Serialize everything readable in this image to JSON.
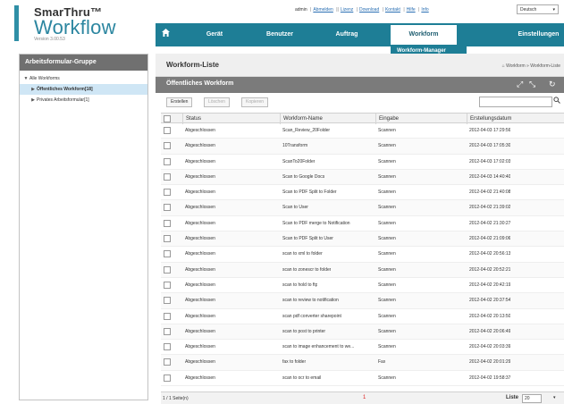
{
  "header": {
    "brand": "SmarThru™",
    "app_name": "Workflow",
    "version": "Version 3.00.53",
    "user": "admin",
    "links": [
      "Abmelden",
      "Lizenz",
      "Download",
      "Kontakt",
      "Hilfe",
      "Info"
    ],
    "language": "Deutsch"
  },
  "nav": {
    "home_icon": "home-icon",
    "items": [
      "Gerät",
      "Benutzer",
      "Auftrag",
      "Workform",
      "Einstellungen"
    ],
    "active": "Workform",
    "dropdown_item": "Workform-Manager"
  },
  "sidebar": {
    "title": "Arbeitsformular-Gruppe",
    "root": "Alle Workforms",
    "items": [
      "Öffentliches Workform[18]",
      "Privates Arbeitsformular[1]"
    ]
  },
  "main": {
    "title": "Workform-Liste",
    "breadcrumb": "Workform » Workform-Liste",
    "subtitle": "Öffentliches Workform",
    "toolbar": [
      "Erstellen",
      "Löschen",
      "Kopieren"
    ],
    "search_placeholder": "",
    "columns": [
      "Status",
      "Workform-Name",
      "Eingabe",
      "Erstellungsdatum"
    ],
    "rows": [
      [
        "Abgeschlossen",
        "Scan_Review_20Folder",
        "Scannen",
        "2012-04-03 17:29:56"
      ],
      [
        "Abgeschlossen",
        "10Transform",
        "Scannen",
        "2012-04-03 17:05:30"
      ],
      [
        "Abgeschlossen",
        "ScanTo20Folder",
        "Scannen",
        "2012-04-03 17:02:03"
      ],
      [
        "Abgeschlossen",
        "Scan to Google Docs",
        "Scannen",
        "2012-04-03 14:40:40"
      ],
      [
        "Abgeschlossen",
        "Scan to PDF Split to Folder",
        "Scannen",
        "2012-04-02 21:40:08"
      ],
      [
        "Abgeschlossen",
        "Scan to User",
        "Scannen",
        "2012-04-02 21:39:02"
      ],
      [
        "Abgeschlossen",
        "Scan to PDF merge to Notification",
        "Scannen",
        "2012-04-02 21:30:27"
      ],
      [
        "Abgeschlossen",
        "Scan to PDF Split to User",
        "Scannen",
        "2012-04-02 21:09:06"
      ],
      [
        "Abgeschlossen",
        "scan to xml to folder",
        "Scannen",
        "2012-04-02 20:56:13"
      ],
      [
        "Abgeschlossen",
        "scan to zonescr to folder",
        "Scannen",
        "2012-04-02 20:52:21"
      ],
      [
        "Abgeschlossen",
        "scan to hold to ftp",
        "Scannen",
        "2012-04-02 20:42:19"
      ],
      [
        "Abgeschlossen",
        "scan to review to notification",
        "Scannen",
        "2012-04-02 20:37:54"
      ],
      [
        "Abgeschlossen",
        "scan pdf converter sharepoint",
        "Scannen",
        "2012-04-02 20:13:50"
      ],
      [
        "Abgeschlossen",
        "scan to post to printer",
        "Scannen",
        "2012-04-02 20:06:49"
      ],
      [
        "Abgeschlossen",
        "scan to image enhancement to we...",
        "Scannen",
        "2012-04-02 20:03:39"
      ],
      [
        "Abgeschlossen",
        "fax to folder",
        "Fax",
        "2012-04-02 20:01:29"
      ],
      [
        "Abgeschlossen",
        "scan to ocr to email",
        "Scannen",
        "2012-04-02 19:58:37"
      ]
    ],
    "footer": {
      "pages": "1 / 1 Seite(n)",
      "count": "1",
      "liste_label": "Liste",
      "page_size": "20"
    }
  },
  "colors": {
    "accent": "#1e7e96",
    "panel_header": "#707070",
    "selected": "#cfe6f5"
  }
}
